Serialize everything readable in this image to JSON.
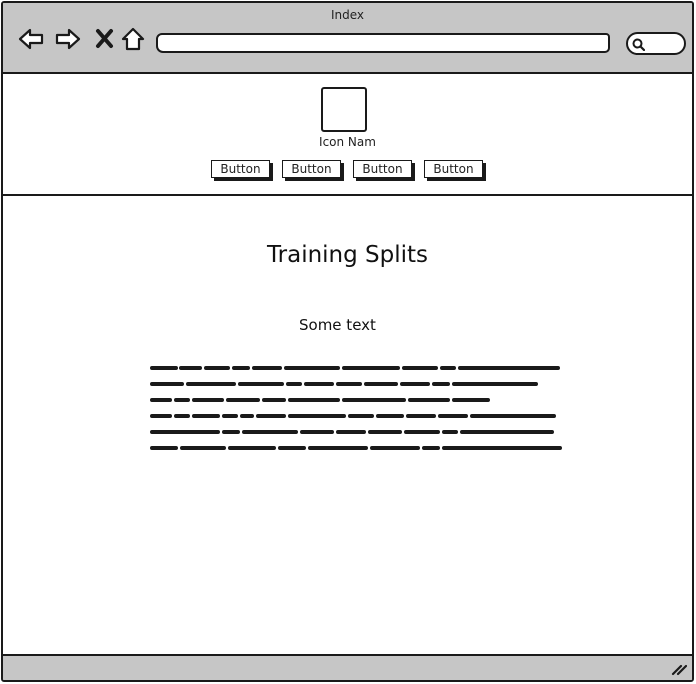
{
  "window": {
    "title": "Index"
  },
  "toolbar": {
    "icons": [
      "back-arrow-icon",
      "forward-arrow-icon",
      "close-x-icon",
      "home-icon",
      "search-icon"
    ],
    "address_value": ""
  },
  "header": {
    "icon_label": "Icon Nam",
    "buttons": [
      {
        "label": "Button"
      },
      {
        "label": "Button"
      },
      {
        "label": "Button"
      },
      {
        "label": "Button"
      }
    ]
  },
  "main": {
    "heading": "Training Splits",
    "subtext": "Some text"
  },
  "colors": {
    "chrome": "#c6c6c6",
    "ink": "#1a1a1a",
    "page": "#ffffff"
  }
}
